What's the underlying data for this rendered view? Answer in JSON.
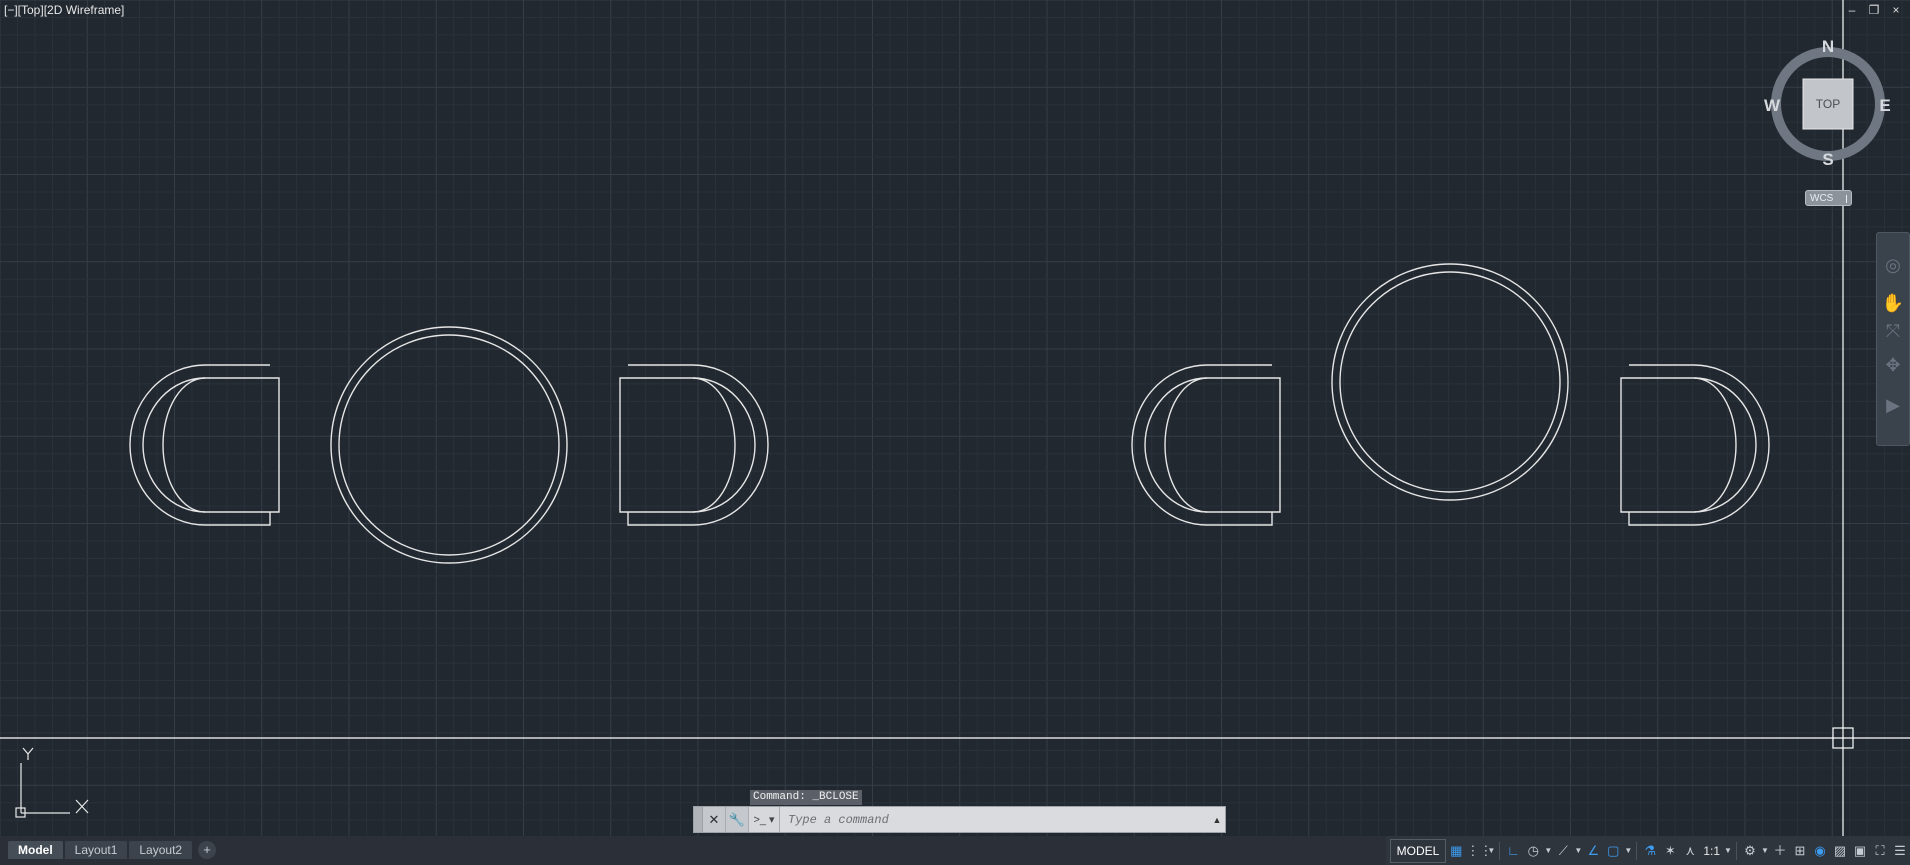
{
  "viewport": {
    "label": "[−][Top][2D Wireframe]",
    "window_controls": [
      "–",
      "❐",
      "×"
    ]
  },
  "viewcube": {
    "face": "TOP",
    "north": "N",
    "south": "S",
    "east": "E",
    "west": "W",
    "wcs_label": "WCS"
  },
  "ucs": {
    "x_label": "X",
    "y_label": "Y"
  },
  "command": {
    "history": "Command:  _BCLOSE",
    "placeholder": "Type a command",
    "close_glyph": "✕",
    "customize_glyph": "🔧",
    "prompt_glyph": ">_ ▾",
    "dropdown_glyph": "▲"
  },
  "tabs": [
    {
      "label": "Model",
      "active": true
    },
    {
      "label": "Layout1",
      "active": false
    },
    {
      "label": "Layout2",
      "active": false
    }
  ],
  "tab_add": "+",
  "status": {
    "model_label": "MODEL",
    "scale_label": "1:1",
    "icons": [
      "grid-icon",
      "snap-icon",
      "ortho-icon",
      "polar-icon",
      "osnap-icon",
      "lineweight-icon",
      "selection-cycling-icon",
      "annotation-visibility-icon",
      "autoscale-icon",
      "annotation-scale-icon",
      "workspace-gear-icon",
      "plus-icon",
      "units-icon",
      "isolate-icon",
      "hardware-accel-icon",
      "clean-screen-icon",
      "customize-icon"
    ]
  },
  "colors": {
    "background": "#212830",
    "grid_minor": "#2a313a",
    "grid_major": "#353d48",
    "geometry": "#e6e6e6",
    "accent": "#3c9cf0"
  }
}
